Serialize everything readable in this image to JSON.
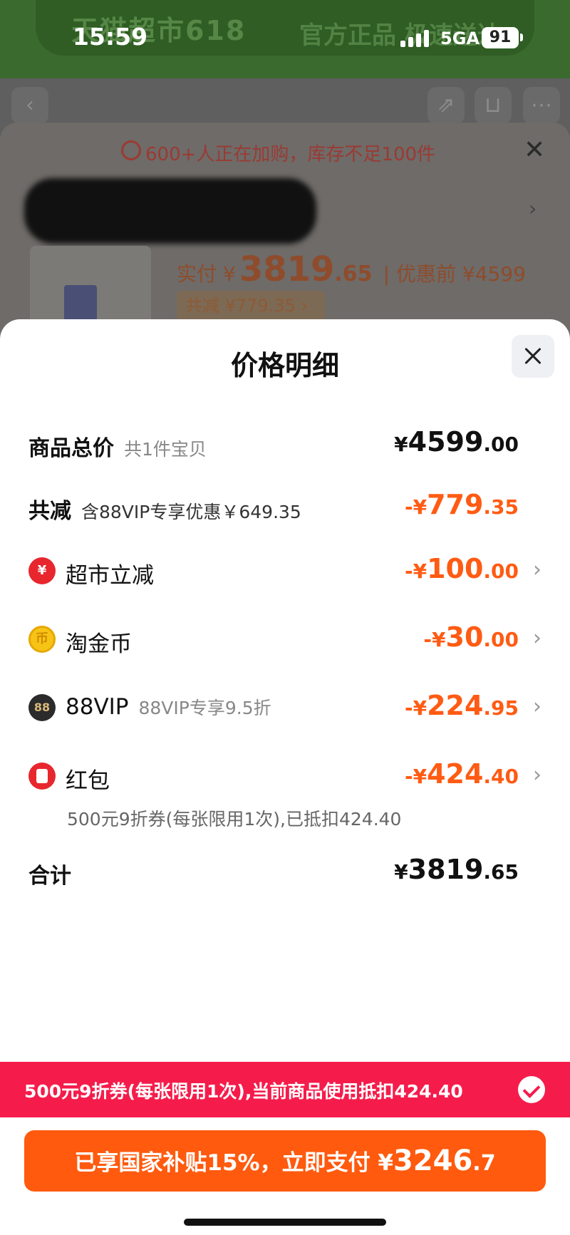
{
  "status_bar": {
    "time": "15:59",
    "network": "5GA",
    "battery": "91"
  },
  "background": {
    "banner_left": "天猫超市618",
    "banner_right": "官方正品 极速送达",
    "alert": "600+人正在加购，库存不足100件",
    "price_label": "实付 ¥",
    "price_int": "3819",
    "price_dec": ".65",
    "before_label": "| 优惠前 ¥4599",
    "discount_tag": "共减 ¥779.35 ›"
  },
  "sheet": {
    "title": "价格明细",
    "total": {
      "label": "商品总价",
      "sub": "共1件宝贝",
      "currency": "¥",
      "int": "4599",
      "dec": ".00"
    },
    "reduction": {
      "label": "共减",
      "sub": "含88VIP专享优惠￥649.35",
      "currency": "-¥",
      "int": "779",
      "dec": ".35"
    },
    "items": [
      {
        "icon": "supermarket-discount-icon",
        "label": "超市立减",
        "sub": "",
        "currency": "-¥",
        "int": "100",
        "dec": ".00"
      },
      {
        "icon": "taojinbi-coin-icon",
        "label": "淘金币",
        "sub": "",
        "currency": "-¥",
        "int": "30",
        "dec": ".00"
      },
      {
        "icon": "88vip-icon",
        "label": "88VIP",
        "sub": "88VIP专享9.5折",
        "currency": "-¥",
        "int": "224",
        "dec": ".95"
      },
      {
        "icon": "red-packet-icon",
        "label": "红包",
        "sub": "",
        "currency": "-¥",
        "int": "424",
        "dec": ".40"
      }
    ],
    "red_packet_note": "500元9折券(每张限用1次),已抵扣424.40",
    "sum": {
      "label": "合计",
      "currency": "¥",
      "int": "3819",
      "dec": ".65"
    }
  },
  "coupon_bar": {
    "text": "500元9折券(每张限用1次),当前商品使用抵扣424.40"
  },
  "pay_button": {
    "text": "已享国家补贴15%，立即支付 ¥",
    "int": "3246",
    "dec": ".7"
  },
  "colors": {
    "accent_orange": "#ff5a0e",
    "coupon_red": "#f51c4b",
    "discount_orange": "#ff5b13"
  }
}
